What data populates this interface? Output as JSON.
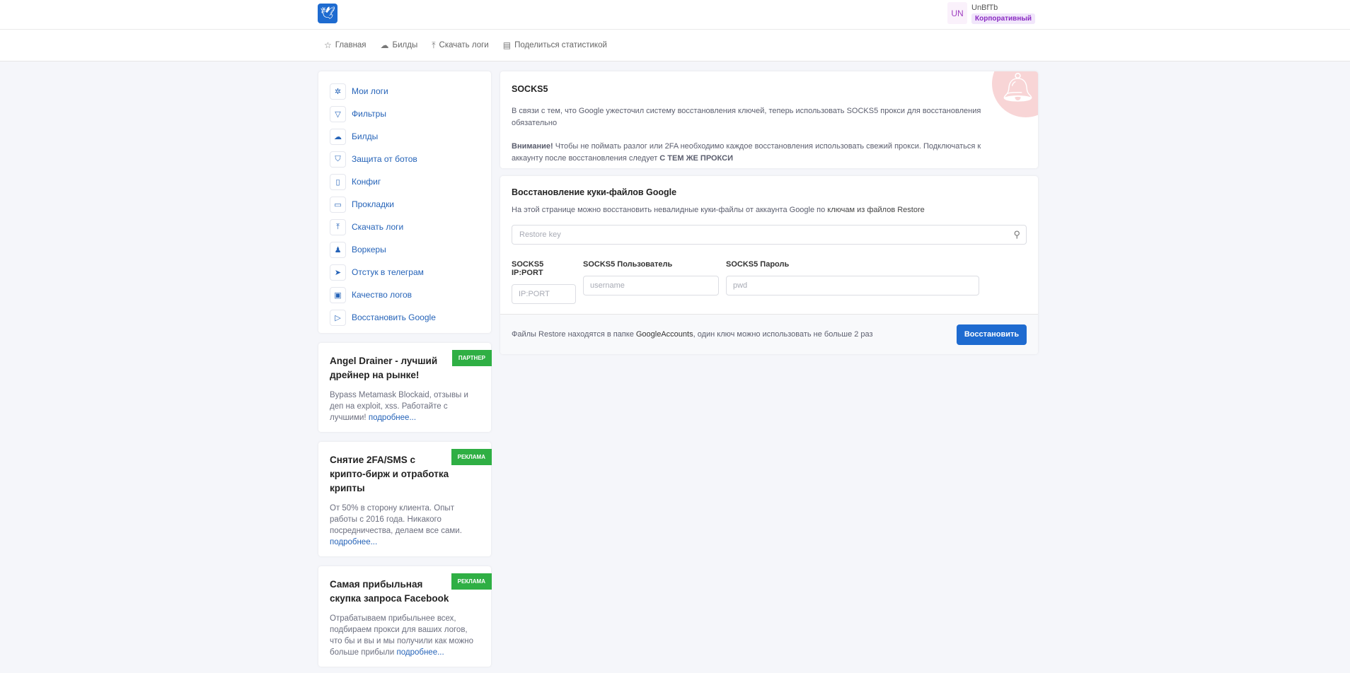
{
  "header": {
    "user_initials": "UN",
    "username": "UnBfTb",
    "plan": "Корпоративный"
  },
  "nav": [
    {
      "label": "Главная",
      "icon": "star-icon"
    },
    {
      "label": "Билды",
      "icon": "cloud-download-icon"
    },
    {
      "label": "Скачать логи",
      "icon": "upload-icon"
    },
    {
      "label": "Поделиться статистикой",
      "icon": "chat-icon"
    }
  ],
  "sidebar": {
    "items": [
      {
        "label": "Мои логи"
      },
      {
        "label": "Фильтры"
      },
      {
        "label": "Билды"
      },
      {
        "label": "Защита от ботов"
      },
      {
        "label": "Конфиг"
      },
      {
        "label": "Прокладки"
      },
      {
        "label": "Скачать логи"
      },
      {
        "label": "Воркеры"
      },
      {
        "label": "Отстук в телеграм"
      },
      {
        "label": "Качество логов"
      },
      {
        "label": "Восстановить Google"
      }
    ]
  },
  "ads": [
    {
      "title": "Angel Drainer - лучший дрейнер на рынке!",
      "text": "Bypass Metamask Blockaid, отзывы и деп на exploit, xss. Работайте с лучшими!",
      "more": "подробнее...",
      "tag": "ПАРТНЕР"
    },
    {
      "title": "Снятие 2FA/SMS с крипто-бирж и отработка крипты",
      "text": "От 50% в сторону клиента. Опыт работы с 2016 года. Никакого посредничества, делаем все сами.",
      "more": "подробнее...",
      "tag": "РЕКЛАМА"
    },
    {
      "title": "Самая прибыльная скупка запроса Facebook",
      "text": "Отрабатываем прибыльнее всех, подбираем прокси для ваших логов, что бы и вы и мы получили как можно больше прибыли",
      "more": "подробнее...",
      "tag": "РЕКЛАМА"
    }
  ],
  "notice": {
    "title": "SOCKS5",
    "p1": "В связи с тем, что Google ужесточил систему восстановления ключей, теперь использовать SOCKS5 прокси для восстановления обязательно",
    "p2_strong": "Внимание!",
    "p2": " Чтобы не поймать разлог или 2FA необходимо каждое восстановления использовать свежий прокси. Подключаться к аккаунту после восстановления следует ",
    "p2_end": "С ТЕМ ЖЕ ПРОКСИ"
  },
  "restore": {
    "title": "Восстановление куки-файлов Google",
    "subtitle_a": "На этой странице можно восстановить невалидные куки-файлы от аккаунта Google по ",
    "subtitle_b": "ключам из файлов Restore",
    "key_placeholder": "Restore key",
    "ip_label": "SOCKS5 IP:PORT",
    "ip_placeholder": "IP:PORT",
    "user_label": "SOCKS5 Пользователь",
    "user_placeholder": "username",
    "pwd_label": "SOCKS5 Пароль",
    "pwd_placeholder": "pwd",
    "footer_a": "Файлы Restore находятся в папке ",
    "footer_b": "GoogleAccounts",
    "footer_c": ", один ключ можно использовать не больше 2 раз",
    "button": "Восстановить"
  }
}
